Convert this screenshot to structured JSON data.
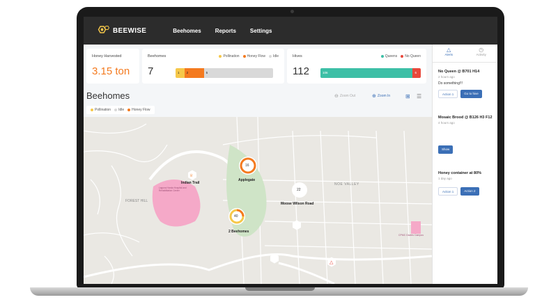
{
  "brand": {
    "name": "BEEWISE"
  },
  "nav": {
    "items": [
      "Beehomes",
      "Reports",
      "Settings"
    ]
  },
  "cards": {
    "honey": {
      "title": "Honey Harvested",
      "value": "3.15 ton"
    },
    "beehomes": {
      "title": "Beehomes",
      "value": "7",
      "legend": [
        "Pollination",
        "Honey Flow",
        "Idle"
      ],
      "bar": [
        {
          "label": "1",
          "fraction": 0.09
        },
        {
          "label": "2",
          "fraction": 0.2
        },
        {
          "label": "5",
          "fraction": 0.71
        }
      ]
    },
    "hives": {
      "title": "Hives",
      "value": "112",
      "legend": [
        "Queens",
        "No Queen"
      ],
      "bar": [
        {
          "label": "106",
          "fraction": 0.92
        },
        {
          "label": "6",
          "fraction": 0.08
        }
      ]
    }
  },
  "section": {
    "title": "Beehomes",
    "chips": [
      "Pollination",
      "Idle",
      "Honey Flow"
    ],
    "zoom_out": "Zoom Out",
    "zoom_in": "Zoom In"
  },
  "map": {
    "labels": {
      "indian_trail": "Indian Trail",
      "applegate": "Applegate",
      "moose_wilson": "Moose Wilson Road",
      "noe_valley": "NOE VALLEY",
      "beehomes_2": "2 Beehomes",
      "forest_hill": "FOREST HILL",
      "laguna": "Laguna Honda Hospital and Rehabilitation Center",
      "cpmc": "CPMC Davies Campus"
    },
    "clusters": {
      "c16": "16",
      "c40": "40",
      "c22": "22"
    }
  },
  "panel": {
    "tabs": [
      "Alerts",
      "Activity"
    ],
    "alerts": [
      {
        "title": "No Queen @ B701 H14",
        "time": "2 hours ago",
        "text": "Do something!!!",
        "actions": [
          "Action 1",
          "Go to hive"
        ]
      },
      {
        "title": "Mosaic Brood @ B126 H3 F12",
        "time": "4 hours ago",
        "actions": [
          "Show"
        ]
      },
      {
        "title": "Honey container at 80%",
        "time": "1 day ago",
        "actions": [
          "Action 1",
          "Action 2"
        ]
      }
    ]
  },
  "colors": {
    "accent": "#f47a1f",
    "blue": "#3b6fb6",
    "pollination": "#f6c84a",
    "honeyflow": "#f47a1f",
    "idle": "#d9d9d9",
    "queens": "#3dbfa6",
    "noqueen": "#e8483b"
  }
}
